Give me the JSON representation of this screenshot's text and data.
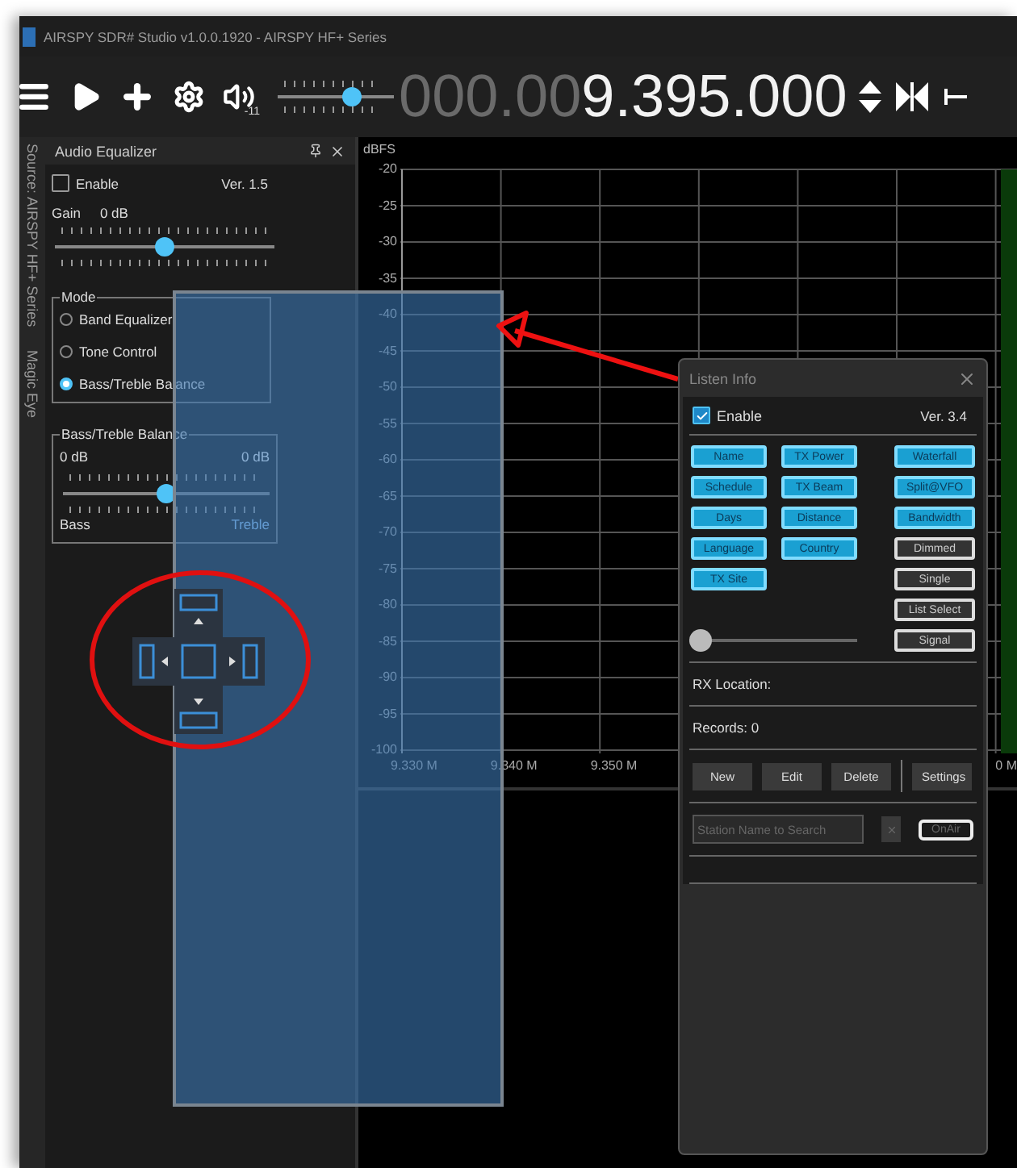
{
  "window": {
    "title": "AIRSPY SDR# Studio v1.0.0.1920 - AIRSPY HF+ Series"
  },
  "toolbar": {
    "volume": {
      "level": 0.64
    },
    "volume_reading": "-11",
    "frequency_dim": "000.00",
    "frequency": "9.395.000"
  },
  "side_tabs": [
    "Source: AIRSPY HF+ Series",
    "Magic Eye"
  ],
  "audio_equalizer": {
    "title": "Audio Equalizer",
    "enable": {
      "label": "Enable",
      "checked": false
    },
    "version": "Ver. 1.5",
    "gain_label": "Gain",
    "gain_value": "0 dB",
    "gain": {
      "level": 0.5
    },
    "mode": {
      "legend": "Mode",
      "options": [
        {
          "label": "Band Equalizer",
          "selected": false
        },
        {
          "label": "Tone Control",
          "selected": false
        },
        {
          "label": "Bass/Treble Balance",
          "selected": true
        }
      ]
    },
    "balance": {
      "legend": "Bass/Treble Balance",
      "left_value": "0 dB",
      "right_value": "0 dB",
      "level": 0.5,
      "left_label": "Bass",
      "right_label": "Treble"
    }
  },
  "spectrum": {
    "unit": "dBFS",
    "y_ticks": [
      "-20",
      "-25",
      "-30",
      "-35",
      "-40",
      "-45",
      "-50",
      "-55",
      "-60",
      "-65",
      "-70",
      "-75",
      "-80",
      "-85",
      "-90",
      "-95",
      "-100"
    ],
    "x_ticks": [
      "9.330 M",
      "9.340 M",
      "9.350 M",
      "0 M"
    ]
  },
  "listen_info": {
    "title": "Listen Info",
    "enable": {
      "label": "Enable",
      "checked": true
    },
    "version": "Ver. 3.4",
    "toggle_columns": [
      [
        {
          "label": "Name",
          "on": true
        },
        {
          "label": "Schedule",
          "on": true
        },
        {
          "label": "Days",
          "on": true
        },
        {
          "label": "Language",
          "on": true
        },
        {
          "label": "TX Site",
          "on": true
        }
      ],
      [
        {
          "label": "TX Power",
          "on": true
        },
        {
          "label": "TX Beam",
          "on": true
        },
        {
          "label": "Distance",
          "on": true
        },
        {
          "label": "Country",
          "on": true
        }
      ],
      [
        {
          "label": "Waterfall",
          "on": true
        },
        {
          "label": "Split@VFO",
          "on": true
        },
        {
          "label": "Bandwidth",
          "on": true
        },
        {
          "label": "Dimmed",
          "on": false
        },
        {
          "label": "Single",
          "on": false
        },
        {
          "label": "List Select",
          "on": false
        },
        {
          "label": "Signal",
          "on": false
        }
      ]
    ],
    "opacity": {
      "level": 0
    },
    "rx_location": "RX Location:",
    "records": "Records: 0",
    "actions": [
      "New",
      "Edit",
      "Delete"
    ],
    "settings": "Settings",
    "search": {
      "placeholder": "Station Name to Search"
    },
    "onair": "OnAir"
  }
}
